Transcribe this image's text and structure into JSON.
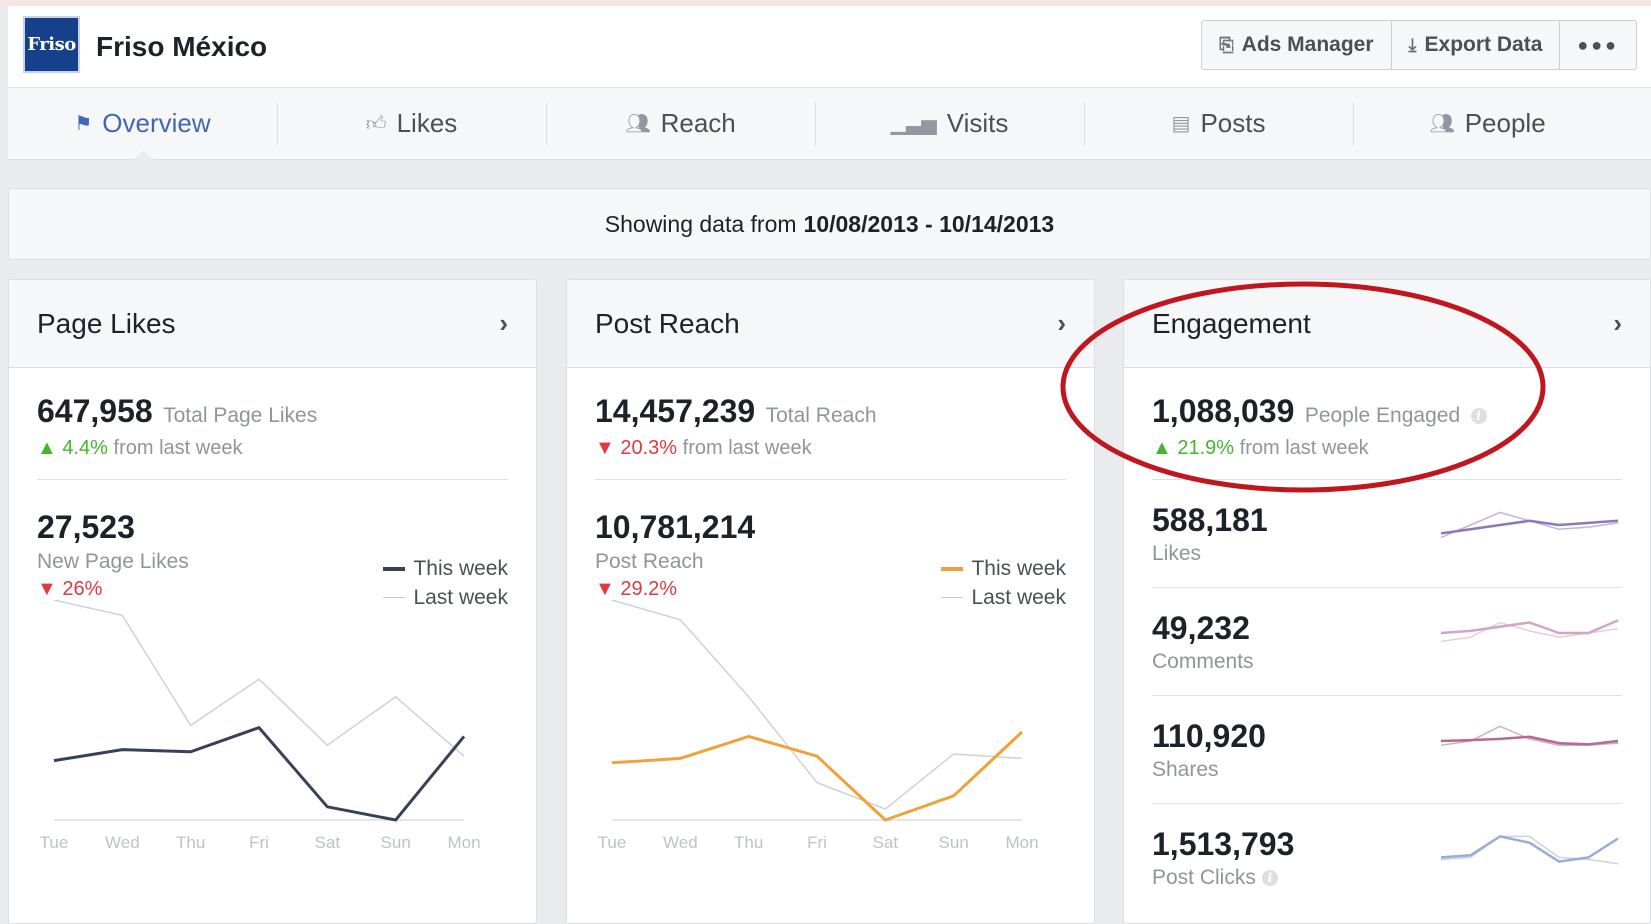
{
  "page": {
    "name": "Friso México",
    "logo_text": "Friso"
  },
  "header_buttons": {
    "ads_manager": "Ads Manager",
    "export_data": "Export Data",
    "more": "●●●"
  },
  "tabs": [
    {
      "label": "Overview",
      "icon": "flag-icon"
    },
    {
      "label": "Likes",
      "icon": "thumbs-up-icon"
    },
    {
      "label": "Reach",
      "icon": "people-icon"
    },
    {
      "label": "Visits",
      "icon": "bar-chart-icon"
    },
    {
      "label": "Posts",
      "icon": "posts-icon"
    },
    {
      "label": "People",
      "icon": "group-icon"
    }
  ],
  "date_range": {
    "prefix": "Showing data from",
    "range": "10/08/2013 - 10/14/2013"
  },
  "legend": {
    "this_week": "This week",
    "last_week": "Last week"
  },
  "colors": {
    "accent": "#4267b2",
    "up": "#42b72a",
    "down": "#e0393e",
    "likes_line": "#37415a",
    "reach_line": "#f0a23a",
    "highlight": "#c0161d"
  },
  "page_likes": {
    "title": "Page Likes",
    "total": "647,958",
    "total_label": "Total Page Likes",
    "change_pct": "4.4%",
    "change_text": "from last week",
    "new": "27,523",
    "new_label": "New Page Likes",
    "new_pct": "26%"
  },
  "post_reach": {
    "title": "Post Reach",
    "total": "14,457,239",
    "total_label": "Total Reach",
    "change_pct": "20.3%",
    "change_text": "from last week",
    "sub": "10,781,214",
    "sub_label": "Post Reach",
    "sub_pct": "29.2%"
  },
  "engagement": {
    "title": "Engagement",
    "total": "1,088,039",
    "total_label": "People Engaged",
    "change_pct": "21.9%",
    "change_text": "from last week",
    "rows": [
      {
        "value": "588,181",
        "label": "Likes"
      },
      {
        "value": "49,232",
        "label": "Comments"
      },
      {
        "value": "110,920",
        "label": "Shares"
      },
      {
        "value": "1,513,793",
        "label": "Post Clicks"
      }
    ]
  },
  "chart_data": [
    {
      "type": "line",
      "categories": [
        "Tue",
        "Wed",
        "Thu",
        "Fri",
        "Sat",
        "Sun",
        "Mon"
      ],
      "series": [
        {
          "name": "This week",
          "values": [
            0.27,
            0.32,
            0.31,
            0.42,
            0.06,
            0.0,
            0.38
          ]
        },
        {
          "name": "Last week",
          "values": [
            1.0,
            0.93,
            0.43,
            0.64,
            0.34,
            0.56,
            0.29
          ]
        }
      ],
      "ylim": [
        0,
        1
      ]
    },
    {
      "type": "line",
      "categories": [
        "Tue",
        "Wed",
        "Thu",
        "Fri",
        "Sat",
        "Sun",
        "Mon"
      ],
      "series": [
        {
          "name": "This week",
          "values": [
            0.26,
            0.28,
            0.38,
            0.29,
            0.0,
            0.11,
            0.4
          ]
        },
        {
          "name": "Last week",
          "values": [
            1.0,
            0.91,
            0.56,
            0.17,
            0.05,
            0.3,
            0.28
          ]
        }
      ],
      "ylim": [
        0,
        1
      ]
    }
  ],
  "sparklines": [
    {
      "color": "#8e79b8",
      "this_week": [
        0.3,
        0.4,
        0.5,
        0.6,
        0.5,
        0.55,
        0.6
      ],
      "last_week": [
        0.2,
        0.5,
        0.8,
        0.6,
        0.4,
        0.45,
        0.55
      ]
    },
    {
      "color": "#d3a5bf",
      "this_week": [
        0.5,
        0.55,
        0.65,
        0.75,
        0.5,
        0.5,
        0.8
      ],
      "last_week": [
        0.3,
        0.4,
        0.75,
        0.55,
        0.4,
        0.5,
        0.6
      ]
    },
    {
      "color": "#b66b8c",
      "this_week": [
        0.5,
        0.52,
        0.55,
        0.6,
        0.45,
        0.42,
        0.5
      ],
      "last_week": [
        0.4,
        0.5,
        0.85,
        0.55,
        0.4,
        0.4,
        0.45
      ]
    },
    {
      "color": "#99aed6",
      "this_week": [
        0.3,
        0.35,
        0.8,
        0.65,
        0.2,
        0.3,
        0.75
      ],
      "last_week": [
        0.25,
        0.3,
        0.8,
        0.8,
        0.3,
        0.25,
        0.15
      ]
    }
  ]
}
